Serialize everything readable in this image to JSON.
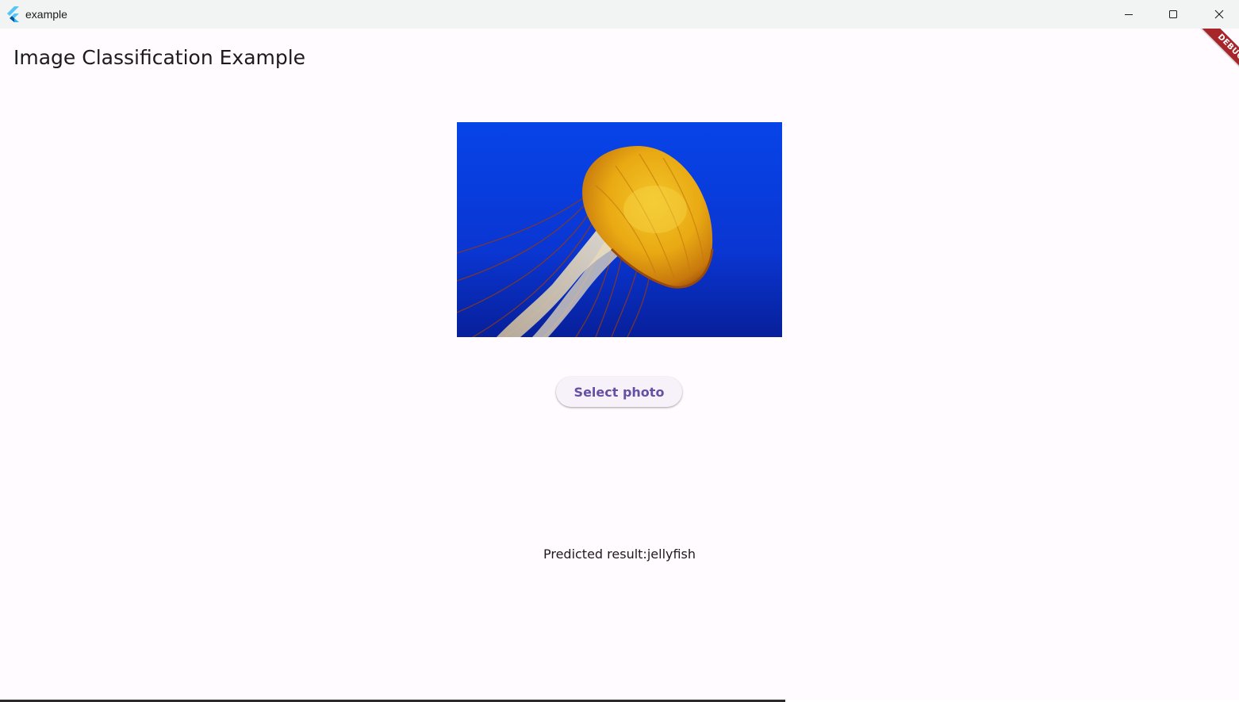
{
  "window": {
    "title": "example",
    "app_icon": "flutter-logo-icon",
    "controls": {
      "minimize": "minimize-icon",
      "maximize": "maximize-icon",
      "close": "close-icon"
    }
  },
  "app_bar": {
    "title": "Image Classification Example"
  },
  "main": {
    "image": "jellyfish photo",
    "select_button_label": "Select photo",
    "result_label": "Predicted result:",
    "result_value": "jellyfish"
  },
  "debug_banner": {
    "label": "DEBUG"
  },
  "colors": {
    "background": "#fffbfe",
    "titlebar": "#f2f4f3",
    "button_text": "#6750a4",
    "button_bg": "#f7f2fa",
    "debug_banner": "#a6262a",
    "photo_water": "#0a3ee0",
    "jellyfish": "#e8a514"
  }
}
